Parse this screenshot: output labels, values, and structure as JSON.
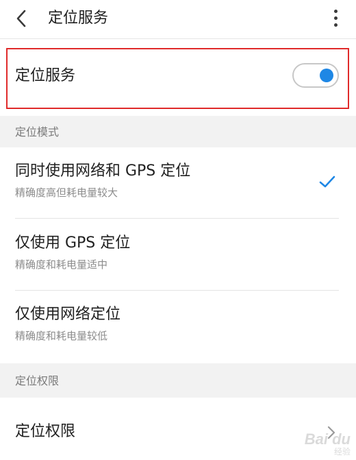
{
  "header": {
    "title": "定位服务",
    "back_icon": "chevron-left-icon",
    "more_icon": "more-vertical-icon"
  },
  "location_toggle": {
    "label": "定位服务",
    "enabled": true,
    "accent_color": "#1e87e5",
    "highlight_color": "#e02a2a"
  },
  "mode_section": {
    "header": "定位模式",
    "options": [
      {
        "title": "同时使用网络和 GPS 定位",
        "subtitle": "精确度高但耗电量较大",
        "selected": true
      },
      {
        "title": "仅使用 GPS 定位",
        "subtitle": "精确度和耗电量适中",
        "selected": false
      },
      {
        "title": "仅使用网络定位",
        "subtitle": "精确度和耗电量较低",
        "selected": false
      }
    ]
  },
  "permission_section": {
    "header": "定位权限",
    "item_label": "定位权限"
  },
  "watermark": {
    "text": "Bai du",
    "subtext": "经验"
  }
}
